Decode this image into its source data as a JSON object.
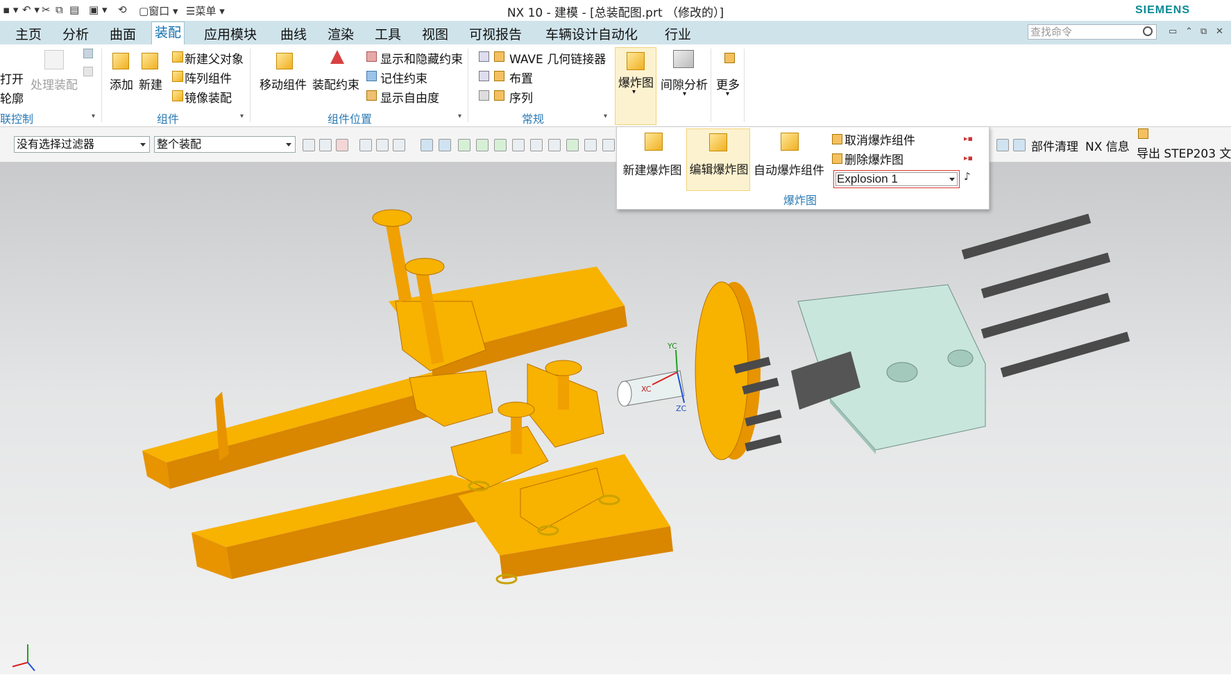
{
  "titlebar": {
    "quick_access": {
      "window_menu": "窗口",
      "menu_menu": "菜单"
    },
    "title": "NX 10 - 建模 - [总装配图.prt （修改的）]",
    "brand": "SIEMENS"
  },
  "tabs": [
    {
      "label": "主页"
    },
    {
      "label": "分析"
    },
    {
      "label": "曲面"
    },
    {
      "label": "装配",
      "active": true
    },
    {
      "label": "应用模块"
    },
    {
      "label": "曲线"
    },
    {
      "label": "渲染"
    },
    {
      "label": "工具"
    },
    {
      "label": "视图"
    },
    {
      "label": "可视报告"
    },
    {
      "label": "车辆设计自动化"
    },
    {
      "label": "行业"
    }
  ],
  "search": {
    "placeholder": "查找命令"
  },
  "ribbon": {
    "group_linked": {
      "open": "打开",
      "outline": "轮廓",
      "process_assembly": "处理装配",
      "label": "联控制"
    },
    "group_component": {
      "add": "添加",
      "new": "新建",
      "new_parent": "新建父对象",
      "array": "阵列组件",
      "mirror": "镜像装配",
      "label": "组件"
    },
    "group_position": {
      "move": "移动组件",
      "constraint": "装配约束",
      "show_hide": "显示和隐藏约束",
      "remember": "记住约束",
      "dof": "显示自由度",
      "label": "组件位置"
    },
    "group_general": {
      "wave": "WAVE 几何链接器",
      "layout": "布置",
      "sequence": "序列",
      "label": "常规"
    },
    "exploded": "爆炸图",
    "clearance": "间隙分析",
    "more": "更多"
  },
  "selbar": {
    "filter": "没有选择过滤器",
    "scope": "整个装配",
    "part_cleanup": "部件清理",
    "nx_info": "NX 信息",
    "export_step": "导出 STEP203 文"
  },
  "popup": {
    "new_explosion": "新建爆炸图",
    "edit_explosion": "编辑爆炸图",
    "auto_explode": "自动爆炸组件",
    "unexplode": "取消爆炸组件",
    "delete_explosion": "删除爆炸图",
    "explosion_value": "Explosion 1",
    "label": "爆炸图"
  },
  "viewport": {
    "axis_labels": {
      "x": "XC",
      "y": "YC",
      "z": "ZC"
    }
  },
  "colors": {
    "part_orange": "#f5a400",
    "cylinder_green": "#c9e6dc",
    "bolt_grey": "#4a4a4a",
    "ribbon_label_blue": "#2c7bb5"
  }
}
